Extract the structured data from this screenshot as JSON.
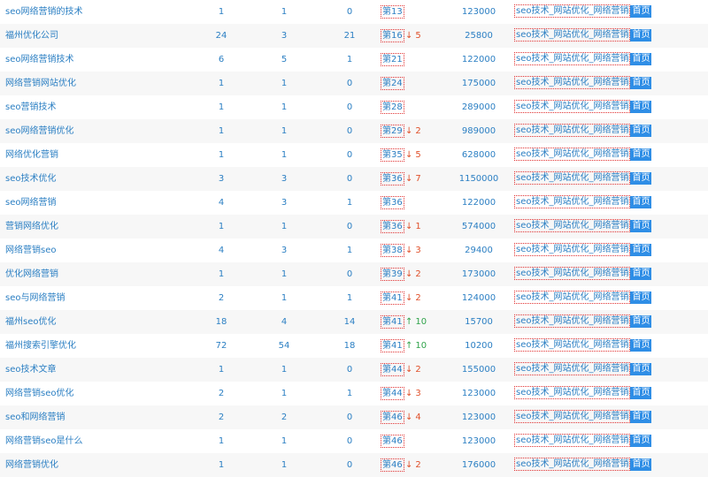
{
  "colors": {
    "link": "#2b7fc3",
    "down": "#e0502a",
    "up": "#2fa34a",
    "tag_bg": "#2f8ee6",
    "border": "#e03030",
    "alt_row": "#f7f7f7"
  },
  "icons": {
    "down": "arrow-down-icon",
    "up": "arrow-up-icon"
  },
  "rows": [
    {
      "keyword": "seo网络营销的技术",
      "c1": "1",
      "c2": "1",
      "c3": "0",
      "rank": "第13",
      "change": "",
      "dir": "",
      "index": "123000",
      "page_title": "seo技术_网站优化_网络营销",
      "page_tag": "首页"
    },
    {
      "keyword": "福州优化公司",
      "c1": "24",
      "c2": "3",
      "c3": "21",
      "rank": "第16",
      "change": "5",
      "dir": "down",
      "index": "25800",
      "page_title": "seo技术_网站优化_网络营销",
      "page_tag": "首页"
    },
    {
      "keyword": "seo网络营销技术",
      "c1": "6",
      "c2": "5",
      "c3": "1",
      "rank": "第21",
      "change": "",
      "dir": "",
      "index": "122000",
      "page_title": "seo技术_网站优化_网络营销",
      "page_tag": "首页"
    },
    {
      "keyword": "网络营销网站优化",
      "c1": "1",
      "c2": "1",
      "c3": "0",
      "rank": "第24",
      "change": "",
      "dir": "",
      "index": "175000",
      "page_title": "seo技术_网站优化_网络营销",
      "page_tag": "首页"
    },
    {
      "keyword": "seo营销技术",
      "c1": "1",
      "c2": "1",
      "c3": "0",
      "rank": "第28",
      "change": "",
      "dir": "",
      "index": "289000",
      "page_title": "seo技术_网站优化_网络营销",
      "page_tag": "首页"
    },
    {
      "keyword": "seo网络营销优化",
      "c1": "1",
      "c2": "1",
      "c3": "0",
      "rank": "第29",
      "change": "2",
      "dir": "down",
      "index": "989000",
      "page_title": "seo技术_网站优化_网络营销",
      "page_tag": "首页"
    },
    {
      "keyword": "网络优化营销",
      "c1": "1",
      "c2": "1",
      "c3": "0",
      "rank": "第35",
      "change": "5",
      "dir": "down",
      "index": "628000",
      "page_title": "seo技术_网站优化_网络营销",
      "page_tag": "首页"
    },
    {
      "keyword": "seo技术优化",
      "c1": "3",
      "c2": "3",
      "c3": "0",
      "rank": "第36",
      "change": "7",
      "dir": "down",
      "index": "1150000",
      "page_title": "seo技术_网站优化_网络营销",
      "page_tag": "首页"
    },
    {
      "keyword": "seo网络营销",
      "c1": "4",
      "c2": "3",
      "c3": "1",
      "rank": "第36",
      "change": "",
      "dir": "",
      "index": "122000",
      "page_title": "seo技术_网站优化_网络营销",
      "page_tag": "首页"
    },
    {
      "keyword": "营销网络优化",
      "c1": "1",
      "c2": "1",
      "c3": "0",
      "rank": "第36",
      "change": "1",
      "dir": "down",
      "index": "574000",
      "page_title": "seo技术_网站优化_网络营销",
      "page_tag": "首页"
    },
    {
      "keyword": "网络营销seo",
      "c1": "4",
      "c2": "3",
      "c3": "1",
      "rank": "第38",
      "change": "3",
      "dir": "down",
      "index": "29400",
      "page_title": "seo技术_网站优化_网络营销",
      "page_tag": "首页"
    },
    {
      "keyword": "优化网络营销",
      "c1": "1",
      "c2": "1",
      "c3": "0",
      "rank": "第39",
      "change": "2",
      "dir": "down",
      "index": "173000",
      "page_title": "seo技术_网站优化_网络营销",
      "page_tag": "首页"
    },
    {
      "keyword": "seo与网络营销",
      "c1": "2",
      "c2": "1",
      "c3": "1",
      "rank": "第41",
      "change": "2",
      "dir": "down",
      "index": "124000",
      "page_title": "seo技术_网站优化_网络营销",
      "page_tag": "首页"
    },
    {
      "keyword": "福州seo优化",
      "c1": "18",
      "c2": "4",
      "c3": "14",
      "rank": "第41",
      "change": "10",
      "dir": "up",
      "index": "15700",
      "page_title": "seo技术_网站优化_网络营销",
      "page_tag": "首页"
    },
    {
      "keyword": "福州搜索引擎优化",
      "c1": "72",
      "c2": "54",
      "c3": "18",
      "rank": "第41",
      "change": "10",
      "dir": "up",
      "index": "10200",
      "page_title": "seo技术_网站优化_网络营销",
      "page_tag": "首页"
    },
    {
      "keyword": "seo技术文章",
      "c1": "1",
      "c2": "1",
      "c3": "0",
      "rank": "第44",
      "change": "2",
      "dir": "down",
      "index": "155000",
      "page_title": "seo技术_网站优化_网络营销",
      "page_tag": "首页"
    },
    {
      "keyword": "网络营销seo优化",
      "c1": "2",
      "c2": "1",
      "c3": "1",
      "rank": "第44",
      "change": "3",
      "dir": "down",
      "index": "123000",
      "page_title": "seo技术_网站优化_网络营销",
      "page_tag": "首页"
    },
    {
      "keyword": "seo和网络营销",
      "c1": "2",
      "c2": "2",
      "c3": "0",
      "rank": "第46",
      "change": "4",
      "dir": "down",
      "index": "123000",
      "page_title": "seo技术_网站优化_网络营销",
      "page_tag": "首页"
    },
    {
      "keyword": "网络营销seo是什么",
      "c1": "1",
      "c2": "1",
      "c3": "0",
      "rank": "第46",
      "change": "",
      "dir": "",
      "index": "123000",
      "page_title": "seo技术_网站优化_网络营销",
      "page_tag": "首页"
    },
    {
      "keyword": "网络营销优化",
      "c1": "1",
      "c2": "1",
      "c3": "0",
      "rank": "第46",
      "change": "2",
      "dir": "down",
      "index": "176000",
      "page_title": "seo技术_网站优化_网络营销",
      "page_tag": "首页"
    }
  ]
}
